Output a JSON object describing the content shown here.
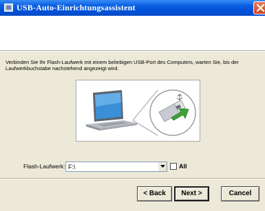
{
  "window": {
    "title": "USB-Auto-Einrichtungsassistent"
  },
  "content": {
    "instruction": "Verbinden Sie Ihr Flash-Laufwerk mit einem beliebigen USB-Port des Computers, warten Sie, bis der Laufwerkbuchstabe nachstehend angezeigt wird."
  },
  "drive": {
    "label": "Flash-Laufwerk:",
    "value": "F:\\",
    "all_label": "All",
    "all_checked": false
  },
  "buttons": {
    "back": "< Back",
    "next": "Next >",
    "cancel": "Cancel"
  },
  "icons": [
    "app-icon",
    "close-icon",
    "laptop-icon",
    "usb-icon",
    "arrow-icon",
    "chevron-down-icon"
  ],
  "colors": {
    "titlebar": "#0a5fe0",
    "dialog_bg": "#ece9d8",
    "arrow_green": "#3fa13a"
  }
}
